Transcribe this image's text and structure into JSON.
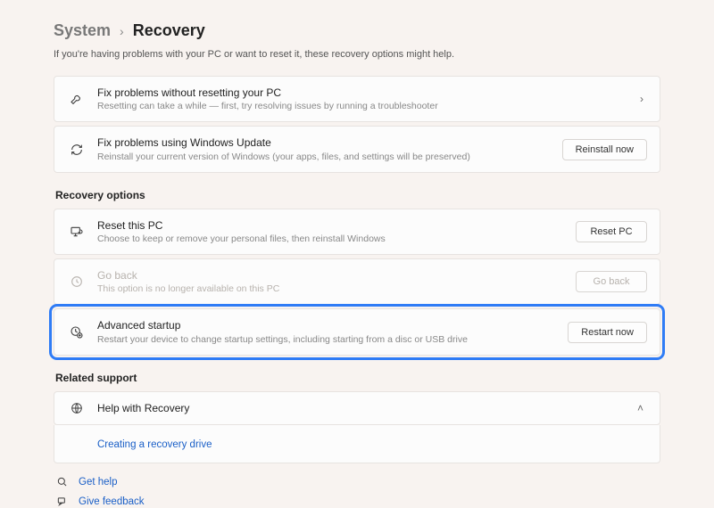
{
  "breadcrumb": {
    "parent": "System",
    "current": "Recovery"
  },
  "intro": "If you're having problems with your PC or want to reset it, these recovery options might help.",
  "top_cards": [
    {
      "icon": "wrench-icon",
      "title": "Fix problems without resetting your PC",
      "sub": "Resetting can take a while — first, try resolving issues by running a troubleshooter",
      "action_type": "chevron"
    },
    {
      "icon": "refresh-icon",
      "title": "Fix problems using Windows Update",
      "sub": "Reinstall your current version of Windows (your apps, files, and settings will be preserved)",
      "action_type": "button",
      "action_label": "Reinstall now"
    }
  ],
  "recovery_section": {
    "label": "Recovery options",
    "items": [
      {
        "icon": "pc-reset-icon",
        "title": "Reset this PC",
        "sub": "Choose to keep or remove your personal files, then reinstall Windows",
        "action_label": "Reset PC",
        "disabled": false,
        "highlighted": false
      },
      {
        "icon": "history-icon",
        "title": "Go back",
        "sub": "This option is no longer available on this PC",
        "action_label": "Go back",
        "disabled": true,
        "highlighted": false
      },
      {
        "icon": "advanced-startup-icon",
        "title": "Advanced startup",
        "sub": "Restart your device to change startup settings, including starting from a disc or USB drive",
        "action_label": "Restart now",
        "disabled": false,
        "highlighted": true
      }
    ]
  },
  "related_section": {
    "label": "Related support",
    "item": {
      "title": "Help with Recovery"
    },
    "sub_link": "Creating a recovery drive"
  },
  "footer_links": {
    "get_help": "Get help",
    "give_feedback": "Give feedback"
  }
}
